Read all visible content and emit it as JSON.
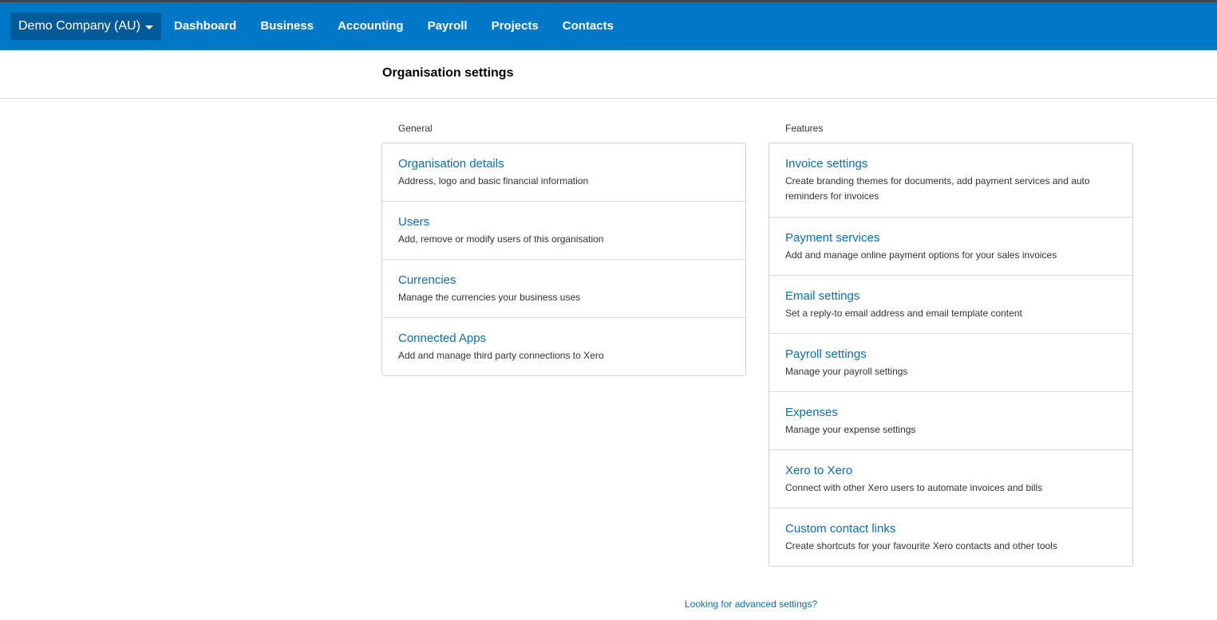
{
  "topbar": {
    "org_name": "Demo Company (AU)",
    "nav": [
      "Dashboard",
      "Business",
      "Accounting",
      "Payroll",
      "Projects",
      "Contacts"
    ]
  },
  "page": {
    "title": "Organisation settings",
    "advanced_link": "Looking for advanced settings?"
  },
  "general": {
    "label": "General",
    "items": [
      {
        "title": "Organisation details",
        "desc": "Address, logo and basic financial information"
      },
      {
        "title": "Users",
        "desc": "Add, remove or modify users of this organisation"
      },
      {
        "title": "Currencies",
        "desc": "Manage the currencies your business uses"
      },
      {
        "title": "Connected Apps",
        "desc": "Add and manage third party connections to Xero"
      }
    ]
  },
  "features": {
    "label": "Features",
    "items": [
      {
        "title": "Invoice settings",
        "desc": "Create branding themes for documents, add payment services and auto reminders for invoices"
      },
      {
        "title": "Payment services",
        "desc": "Add and manage online payment options for your sales invoices"
      },
      {
        "title": "Email settings",
        "desc": "Set a reply-to email address and email template content"
      },
      {
        "title": "Payroll settings",
        "desc": "Manage your payroll settings"
      },
      {
        "title": "Expenses",
        "desc": "Manage your expense settings"
      },
      {
        "title": "Xero to Xero",
        "desc": "Connect with other Xero users to automate invoices and bills"
      },
      {
        "title": "Custom contact links",
        "desc": "Create shortcuts for your favourite Xero contacts and other tools"
      }
    ]
  },
  "colors": {
    "topbar": "#0078c8",
    "org_switcher": "#005a98",
    "link": "#0c6cb5"
  }
}
